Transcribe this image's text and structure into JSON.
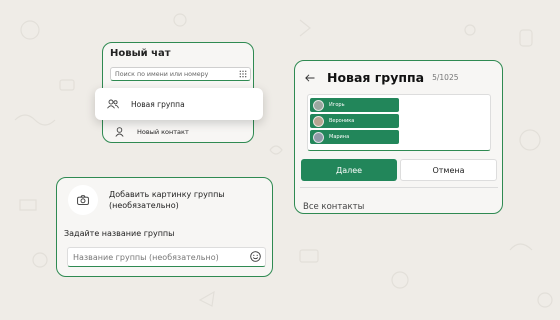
{
  "new_chat": {
    "title": "Новый чат",
    "search_placeholder": "Поиск по имени или номеру",
    "new_group_label": "Новая группа",
    "new_contact_label": "Новый контакт"
  },
  "new_group": {
    "title": "Новая группа",
    "count": "5/1025",
    "participants": [
      {
        "name": "Игорь",
        "avatar_color": "#9aa7a0"
      },
      {
        "name": "Вероника",
        "avatar_color": "#b7a592"
      },
      {
        "name": "Марина",
        "avatar_color": "#8f9aa8"
      }
    ],
    "next_label": "Далее",
    "cancel_label": "Отмена",
    "all_contacts_label": "Все контакты"
  },
  "group_info": {
    "add_image_line1": "Добавить картинку группы",
    "add_image_line2": "(необязательно)",
    "set_name_label": "Задайте название группы",
    "name_placeholder": "Название группы (необязательно)"
  },
  "colors": {
    "accent": "#22865a",
    "border": "#2f8a52",
    "background": "#efece7"
  },
  "icons": [
    "dialpad-icon",
    "group-icon",
    "person-icon",
    "back-arrow-icon",
    "camera-icon",
    "emoji-icon"
  ]
}
